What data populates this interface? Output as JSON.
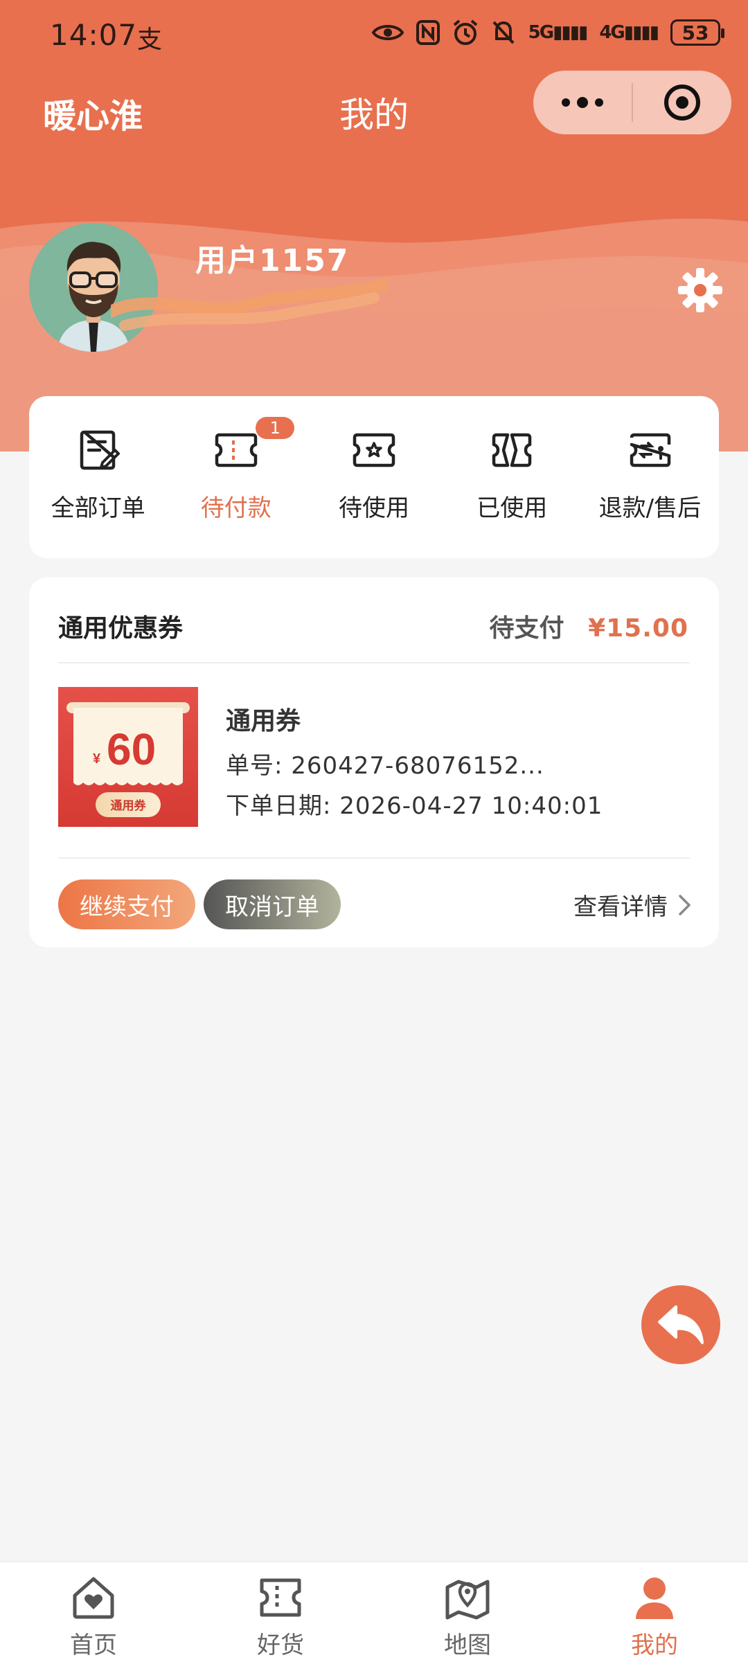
{
  "status_bar": {
    "time": "14:07",
    "alipay_glyph": "支",
    "battery": "53",
    "sig5g": "5G",
    "sig4g": "4G"
  },
  "nav": {
    "brand": "暖心淮",
    "title": "我的"
  },
  "profile": {
    "username": "用户1157"
  },
  "orders": {
    "items": [
      {
        "label": "全部订单",
        "icon": "all-orders-icon"
      },
      {
        "label": "待付款",
        "icon": "pending-payment-icon",
        "badge": "1",
        "active": true
      },
      {
        "label": "待使用",
        "icon": "to-use-icon"
      },
      {
        "label": "已使用",
        "icon": "used-icon"
      },
      {
        "label": "退款/售后",
        "icon": "refund-icon"
      }
    ]
  },
  "order_card": {
    "title": "通用优惠券",
    "status": "待支付",
    "amount": "¥15.00",
    "coupon_value": "60",
    "coupon_currency": "¥",
    "coupon_tag": "通用券",
    "item_name": "通用券",
    "order_no": "单号: 260427-68076152...",
    "order_date": "下单日期: 2026-04-27 10:40:01",
    "pay_label": "继续支付",
    "cancel_label": "取消订单",
    "detail_label": "查看详情"
  },
  "tabbar": {
    "items": [
      {
        "label": "首页"
      },
      {
        "label": "好货"
      },
      {
        "label": "地图"
      },
      {
        "label": "我的",
        "active": true
      }
    ]
  },
  "colors": {
    "accent": "#e8704f",
    "text_accent": "#e0714f"
  }
}
